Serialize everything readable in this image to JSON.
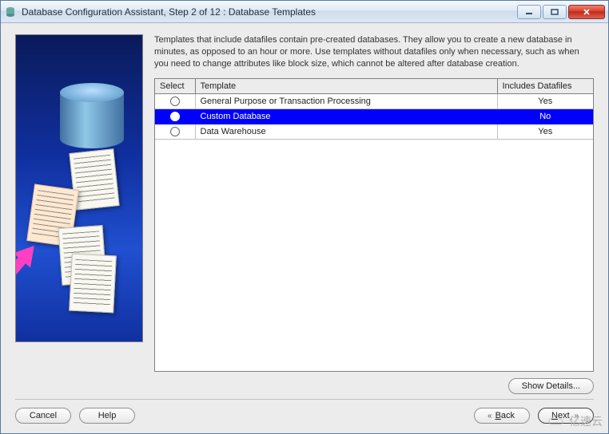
{
  "window": {
    "title": "Database Configuration Assistant, Step 2 of 12 : Database Templates"
  },
  "description": "Templates that include datafiles contain pre-created databases. They allow you to create a new database in minutes, as opposed to an hour or more. Use templates without datafiles only when necessary, such as when you need to change attributes like block size, which cannot be altered after database creation.",
  "table": {
    "headers": {
      "select": "Select",
      "template": "Template",
      "includes": "Includes Datafiles"
    },
    "rows": [
      {
        "template": "General Purpose or Transaction Processing",
        "includes": "Yes",
        "selected": false
      },
      {
        "template": "Custom Database",
        "includes": "No",
        "selected": true
      },
      {
        "template": "Data Warehouse",
        "includes": "Yes",
        "selected": false
      }
    ]
  },
  "buttons": {
    "show_details": "Show Details...",
    "cancel": "Cancel",
    "help": "Help",
    "back": "Back",
    "next": "Next"
  },
  "watermark": "亿速云"
}
